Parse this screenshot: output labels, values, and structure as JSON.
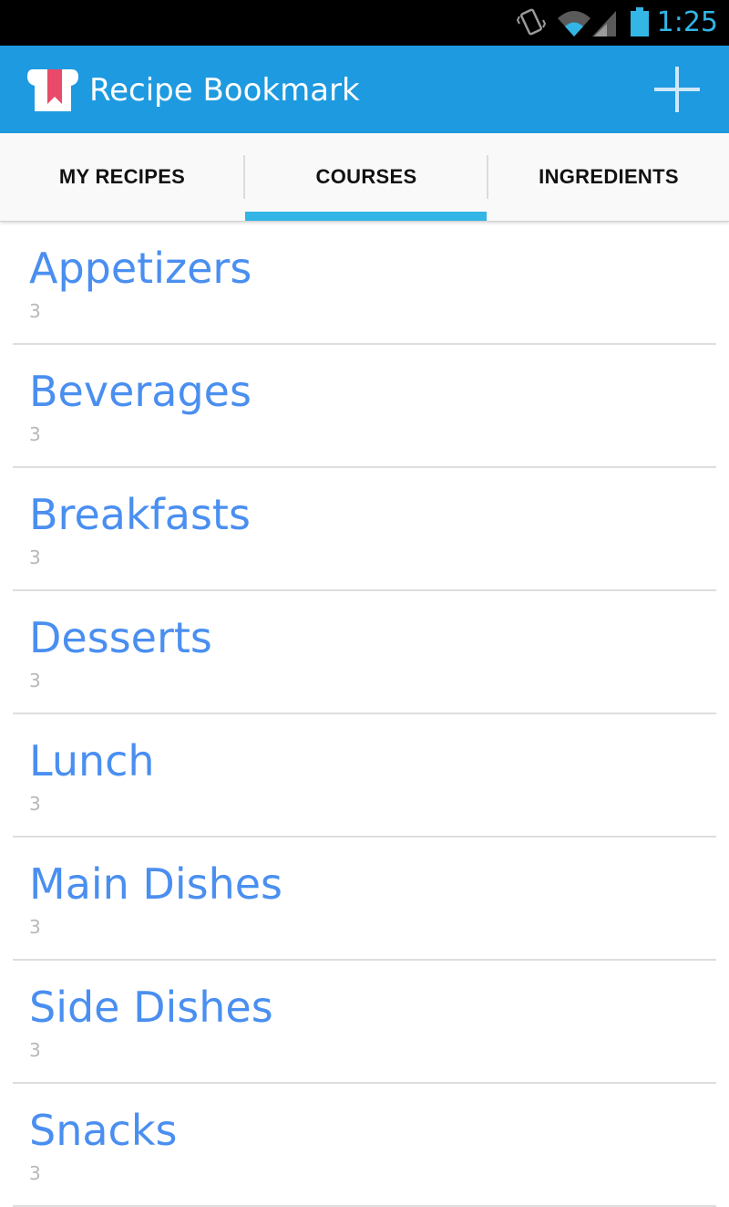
{
  "status_bar": {
    "time": "1:25",
    "icons": [
      "vibrate-icon",
      "wifi-icon",
      "signal-icon",
      "battery-icon"
    ],
    "accent_color": "#33b5e5"
  },
  "action_bar": {
    "title": "Recipe Bookmark",
    "background_color": "#1e9ae0",
    "add_icon": "plus-icon"
  },
  "tabs": [
    {
      "label": "MY RECIPES",
      "selected": false
    },
    {
      "label": "COURSES",
      "selected": true
    },
    {
      "label": "INGREDIENTS",
      "selected": false
    }
  ],
  "courses": [
    {
      "name": "Appetizers",
      "count": "3"
    },
    {
      "name": "Beverages",
      "count": "3"
    },
    {
      "name": "Breakfasts",
      "count": "3"
    },
    {
      "name": "Desserts",
      "count": "3"
    },
    {
      "name": "Lunch",
      "count": "3"
    },
    {
      "name": "Main Dishes",
      "count": "3"
    },
    {
      "name": "Side Dishes",
      "count": "3"
    },
    {
      "name": "Snacks",
      "count": "3"
    }
  ],
  "colors": {
    "item_title": "#4a8ff0",
    "item_count": "#b8b8b8",
    "tab_indicator": "#33b5e5"
  }
}
